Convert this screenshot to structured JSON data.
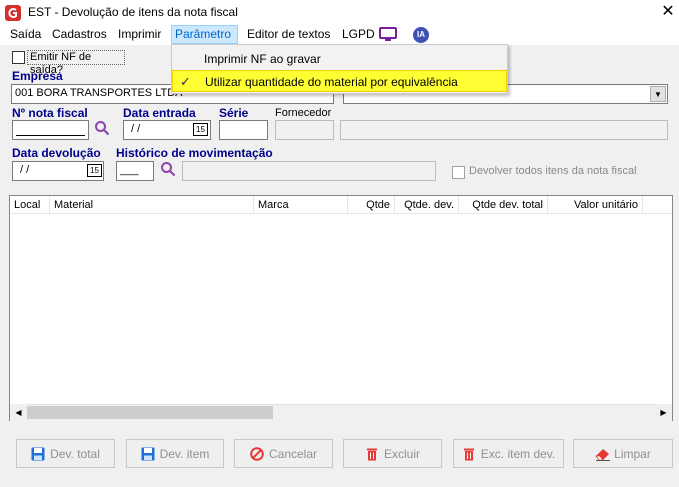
{
  "window": {
    "title": "EST - Devolução de itens da nota fiscal",
    "close_glyph": "✕"
  },
  "menubar": {
    "items": [
      "Saída",
      "Cadastros",
      "Imprimir",
      "Parâmetro",
      "Editor de textos",
      "LGPD"
    ],
    "ia_badge": "IA"
  },
  "parametro_menu": {
    "items": [
      {
        "label": "Imprimir NF ao gravar",
        "checked": false
      },
      {
        "label": "Utilizar quantidade do material por equivalência",
        "checked": true
      }
    ],
    "check_glyph": "✓"
  },
  "form": {
    "emitir_nf_label": "Emitir NF de saída?",
    "empresa_label": "Empresa",
    "empresa_value": "001 BORA TRANSPORTES LTDA",
    "nota_fiscal_label": "Nº nota fiscal",
    "data_entrada_label": "Data entrada",
    "data_entrada_value": "/ /",
    "serie_label": "Série",
    "fornecedor_label": "Fornecedor",
    "data_devolucao_label": "Data devolução",
    "data_devolucao_value": "/ /",
    "historico_label": "Histórico de movimentação",
    "historico_value": "___",
    "devolver_todos_label": "Devolver todos itens da nota fiscal",
    "calendar_glyph": "15"
  },
  "grid": {
    "columns": [
      "Local",
      "Material",
      "Marca",
      "Qtde",
      "Qtde. dev.",
      "Qtde dev. total",
      "Valor unitário"
    ]
  },
  "buttons": [
    {
      "label": "Dev. total",
      "icon": "save-icon"
    },
    {
      "label": "Dev. item",
      "icon": "save-icon"
    },
    {
      "label": "Cancelar",
      "icon": "cancel-icon"
    },
    {
      "label": "Excluir",
      "icon": "trash-icon"
    },
    {
      "label": "Exc. item dev.",
      "icon": "trash-icon"
    },
    {
      "label": "Limpar",
      "icon": "eraser-icon"
    }
  ],
  "colors": {
    "accent_blue": "#00008b",
    "menu_highlight": "#ffff33",
    "brand_red": "#d32f2f",
    "lgpd_purple": "#7b1fa2",
    "ia_blue": "#3f51b5"
  }
}
